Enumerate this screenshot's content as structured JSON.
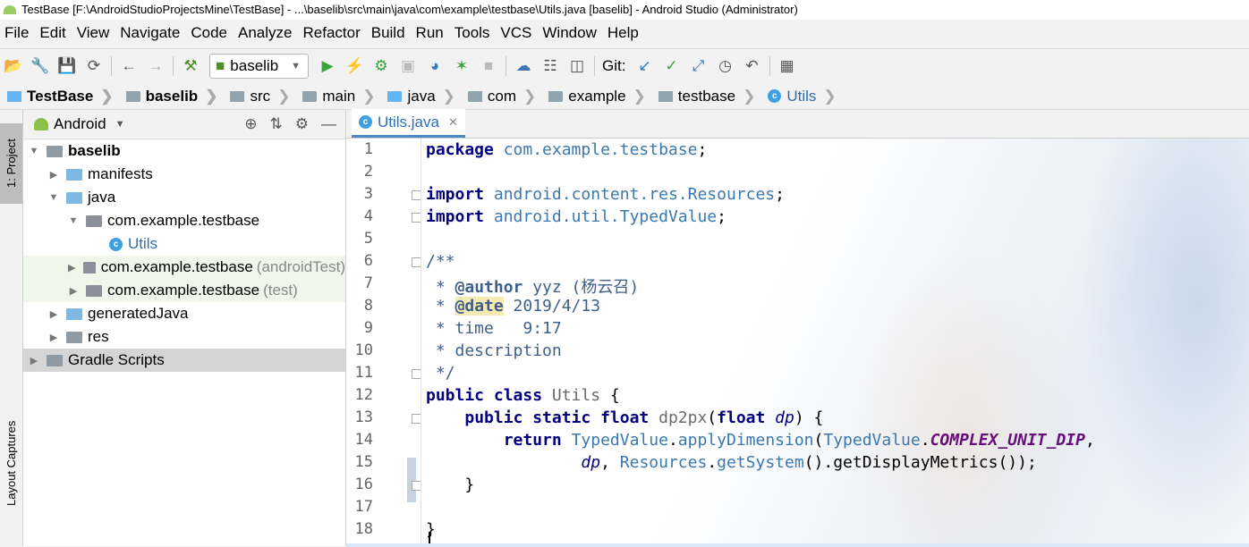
{
  "window": {
    "title": "TestBase [F:\\AndroidStudioProjectsMine\\TestBase] - ...\\baselib\\src\\main\\java\\com\\example\\testbase\\Utils.java [baselib] - Android Studio (Administrator)"
  },
  "menu": [
    "File",
    "Edit",
    "View",
    "Navigate",
    "Code",
    "Analyze",
    "Refactor",
    "Build",
    "Run",
    "Tools",
    "VCS",
    "Window",
    "Help"
  ],
  "toolbar": {
    "run_config": "baselib",
    "git_label": "Git:"
  },
  "breadcrumb": [
    "TestBase",
    "baselib",
    "src",
    "main",
    "java",
    "com",
    "example",
    "testbase",
    "Utils"
  ],
  "side_tabs": {
    "project": "1: Project",
    "captures": "Layout Captures"
  },
  "project_panel": {
    "view_mode": "Android",
    "tree": [
      {
        "label": "baselib",
        "suffix": ""
      },
      {
        "label": "manifests",
        "suffix": ""
      },
      {
        "label": "java",
        "suffix": ""
      },
      {
        "label": "com.example.testbase",
        "suffix": ""
      },
      {
        "label": "Utils",
        "suffix": ""
      },
      {
        "label": "com.example.testbase",
        "suffix": "(androidTest)"
      },
      {
        "label": "com.example.testbase",
        "suffix": "(test)"
      },
      {
        "label": "generatedJava",
        "suffix": ""
      },
      {
        "label": "res",
        "suffix": ""
      },
      {
        "label": "Gradle Scripts",
        "suffix": ""
      }
    ]
  },
  "editor": {
    "tab": "Utils.java",
    "line_numbers": [
      "1",
      "2",
      "3",
      "4",
      "5",
      "6",
      "7",
      "8",
      "9",
      "10",
      "11",
      "12",
      "13",
      "14",
      "15",
      "16",
      "17",
      "18"
    ],
    "code": {
      "l1_kw": "package",
      "l1_pkg": "com.example.testbase",
      "l1_end": ";",
      "l3_kw": "import",
      "l3_pkg": "android.content.res.Resources",
      "l3_end": ";",
      "l4_kw": "import",
      "l4_pkg": "android.util.TypedValue",
      "l4_end": ";",
      "l6": "/**",
      "l7_star": " * ",
      "l7_tag": "@author",
      "l7_text": " yyz (杨云召)",
      "l8_star": " * ",
      "l8_tag": "@date",
      "l8_text": " 2019/4/13",
      "l9": " * time   9:17",
      "l10": " * description",
      "l11": " */",
      "l12_kw": "public class",
      "l12_cls": " Utils",
      "l12_end": " {",
      "l13_indent": "    ",
      "l13_kw": "public static float",
      "l13_m": " dp2px",
      "l13_p1": "(",
      "l13_kw2": "float",
      "l13_param": " dp",
      "l13_end": ") {",
      "l14_indent": "        ",
      "l14_kw": "return",
      "l14_c1": " TypedValue",
      "l14_dot": ".",
      "l14_m": "applyDimension",
      "l14_p": "(",
      "l14_c2": "TypedValue",
      "l14_dot2": ".",
      "l14_const": "COMPLEX_UNIT_DIP",
      "l14_end": ",",
      "l15_indent": "                ",
      "l15_param": "dp",
      "l15_comma": ", ",
      "l15_c": "Resources",
      "l15_dot": ".",
      "l15_m": "getSystem",
      "l15_rest": "().getDisplayMetrics());",
      "l16": "    }",
      "l18": "}"
    }
  }
}
